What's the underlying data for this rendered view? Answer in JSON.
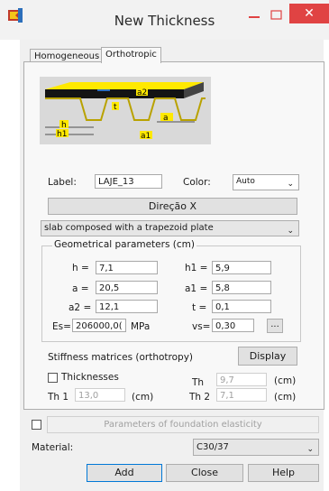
{
  "window": {
    "title": "New Thickness",
    "close_glyph": "✕"
  },
  "tabs": [
    {
      "label": "Homogeneous"
    },
    {
      "label": "Orthotropic"
    }
  ],
  "diagram": {
    "labels": {
      "h": "h",
      "h1": "h1",
      "a": "a",
      "a1": "a1",
      "a2": "a2",
      "t": "t"
    }
  },
  "label_field": {
    "label": "Label:",
    "value": "LAJE_13"
  },
  "color_field": {
    "label": "Color:",
    "value": "Auto"
  },
  "direction_button": "Direção X",
  "slab_type": {
    "value": "slab composed with a trapezoid plate"
  },
  "geometry": {
    "title": "Geometrical parameters (cm)",
    "h": {
      "label": "h =",
      "value": "7,1"
    },
    "h1": {
      "label": "h1 =",
      "value": "5,9"
    },
    "a": {
      "label": "a =",
      "value": "20,5"
    },
    "a1": {
      "label": "a1 =",
      "value": "5,8"
    },
    "a2": {
      "label": "a2 =",
      "value": "12,1"
    },
    "t": {
      "label": "t =",
      "value": "0,1"
    },
    "es": {
      "label": "Es=",
      "value": "206000,0(",
      "unit": "MPa"
    },
    "vs": {
      "label": "vs=",
      "value": "0,30"
    },
    "more_button": "..."
  },
  "stiffness": {
    "label": "Stiffness matrices (orthotropy)",
    "display_button": "Display"
  },
  "thicknesses": {
    "checkbox_label": "Thicknesses",
    "th": {
      "label": "Th",
      "value": "9,7",
      "unit": "(cm)"
    },
    "th1": {
      "label": "Th 1",
      "value": "13,0",
      "unit": "(cm)"
    },
    "th2": {
      "label": "Th 2",
      "value": "7,1",
      "unit": "(cm)"
    }
  },
  "foundation": {
    "label": "Parameters of foundation elasticity"
  },
  "material": {
    "label": "Material:",
    "value": "C30/37"
  },
  "buttons": {
    "add": "Add",
    "close": "Close",
    "help": "Help"
  }
}
